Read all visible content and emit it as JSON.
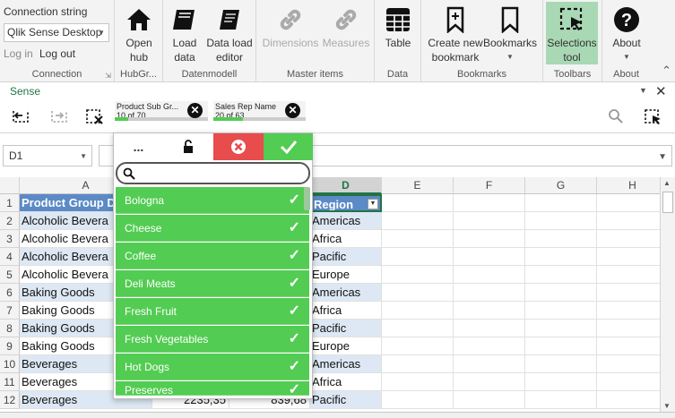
{
  "ribbon": {
    "connection": {
      "label": "Connection string",
      "select_value": "Qlik Sense Desktop",
      "login": "Log in",
      "logout": "Log out",
      "group": "Connection"
    },
    "hubgroup": {
      "open_hub": "Open hub",
      "group": "HubGr..."
    },
    "datenmodell": {
      "load_data": "Load data",
      "data_load_editor": "Data load editor",
      "group": "Datenmodell"
    },
    "master": {
      "dimensions": "Dimensions",
      "measures": "Measures",
      "group": "Master items"
    },
    "data": {
      "table": "Table",
      "group": "Data"
    },
    "bookmarks": {
      "create": "Create new bookmark",
      "bookmarks": "Bookmarks",
      "group": "Bookmarks"
    },
    "toolbars": {
      "selections_tool": "Selections tool",
      "group": "Toolbars"
    },
    "about": {
      "about": "About",
      "group": "About"
    }
  },
  "sense": {
    "title": "Sense",
    "chips": [
      {
        "name": "Product Sub Gr...",
        "count": "10 of 70",
        "fraction": 0.143
      },
      {
        "name": "Sales Rep Name",
        "count": "20 of 63",
        "fraction": 0.317
      }
    ]
  },
  "formula": {
    "namebox": "D1"
  },
  "grid": {
    "columns": [
      "A",
      "B",
      "C",
      "D",
      "E",
      "F",
      "G",
      "H"
    ],
    "rows": [
      {
        "n": "1",
        "a": "Product Group D",
        "d": "Region"
      },
      {
        "n": "2",
        "a": "Alcoholic Bevera",
        "d": "Americas"
      },
      {
        "n": "3",
        "a": "Alcoholic Bevera",
        "d": "Africa"
      },
      {
        "n": "4",
        "a": "Alcoholic Bevera",
        "d": "Pacific"
      },
      {
        "n": "5",
        "a": "Alcoholic Bevera",
        "d": "Europe"
      },
      {
        "n": "6",
        "a": "Baking Goods",
        "d": "Americas"
      },
      {
        "n": "7",
        "a": "Baking Goods",
        "d": "Africa"
      },
      {
        "n": "8",
        "a": "Baking Goods",
        "d": "Pacific"
      },
      {
        "n": "9",
        "a": "Baking Goods",
        "d": "Europe"
      },
      {
        "n": "10",
        "a": "Beverages",
        "d": "Americas"
      },
      {
        "n": "11",
        "a": "Beverages",
        "d": "Africa"
      },
      {
        "n": "12",
        "a": "Beverages",
        "b": "2235,35",
        "c": "839,68",
        "d": "Pacific"
      }
    ]
  },
  "listbox": {
    "more": "...",
    "search_placeholder": "",
    "items": [
      "Bologna",
      "Cheese",
      "Coffee",
      "Deli Meats",
      "Fresh Fruit",
      "Fresh Vegetables",
      "Hot Dogs",
      "Preserves"
    ]
  },
  "colors": {
    "green": "#52cc52",
    "red": "#e84c4c",
    "header_blue": "#5b8ac6",
    "band": "#dde8f4",
    "active_tool": "#a9d8b5"
  }
}
